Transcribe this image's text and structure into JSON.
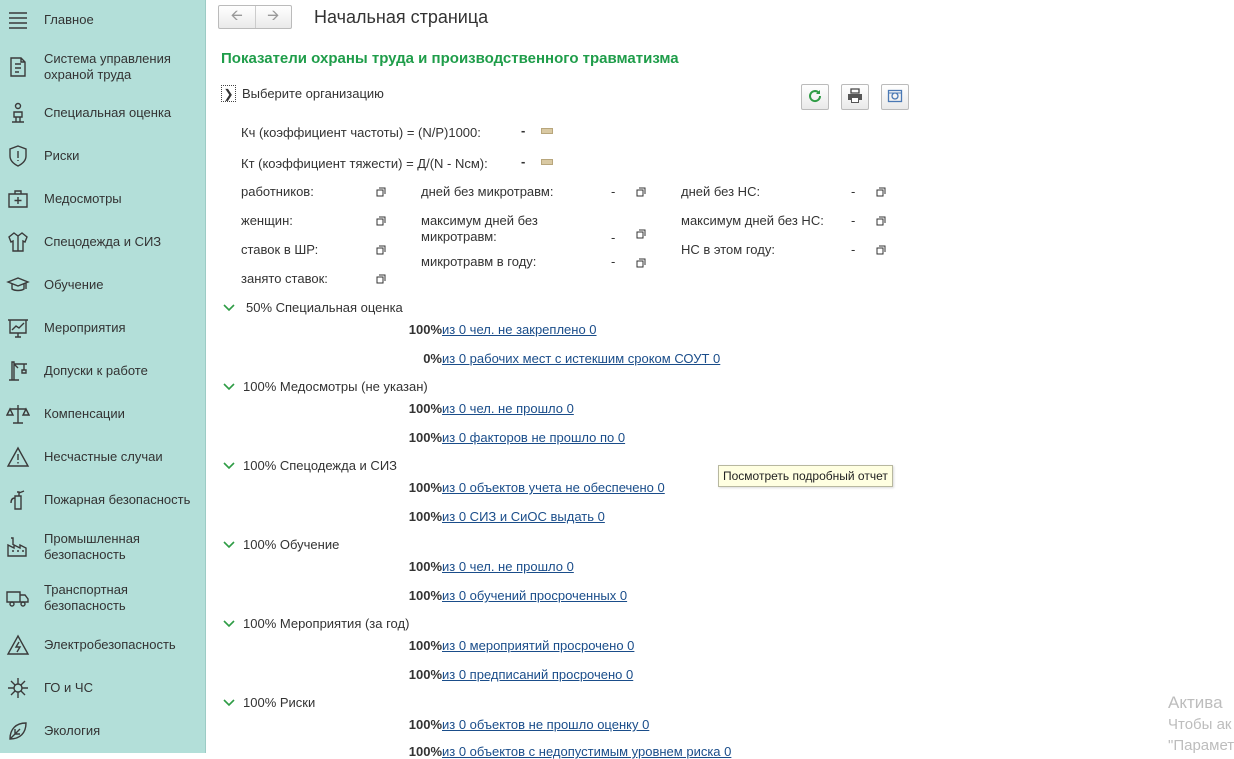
{
  "sidebar": {
    "items": [
      {
        "label": "Главное",
        "icon": "menu-icon"
      },
      {
        "label": "Система управления охраной труда",
        "icon": "document-icon"
      },
      {
        "label": "Специальная оценка",
        "icon": "workplace-chair-icon"
      },
      {
        "label": "Риски",
        "icon": "shield-icon"
      },
      {
        "label": "Медосмотры",
        "icon": "medkit-icon"
      },
      {
        "label": "Спецодежда и СИЗ",
        "icon": "jacket-icon"
      },
      {
        "label": "Обучение",
        "icon": "graduation-cap-icon"
      },
      {
        "label": "Мероприятия",
        "icon": "presentation-chart-icon"
      },
      {
        "label": "Допуски к работе",
        "icon": "crane-icon"
      },
      {
        "label": "Компенсации",
        "icon": "scales-icon"
      },
      {
        "label": "Несчастные случаи",
        "icon": "warning-icon"
      },
      {
        "label": "Пожарная безопасность",
        "icon": "fire-extinguisher-icon"
      },
      {
        "label": "Промышленная безопасность",
        "icon": "factory-icon"
      },
      {
        "label": "Транспортная безопасность",
        "icon": "truck-icon"
      },
      {
        "label": "Электробезопасность",
        "icon": "electric-warning-icon"
      },
      {
        "label": "ГО и ЧС",
        "icon": "civil-defense-icon"
      },
      {
        "label": "Экология",
        "icon": "ecology-icon"
      }
    ]
  },
  "header": {
    "back_icon": "arrow-left-icon",
    "forward_icon": "arrow-right-icon",
    "title": "Начальная страница"
  },
  "main": {
    "section_title": "Показатели охраны труда и производственного травматизма",
    "org_select": "Выберите организацию",
    "toolbar_icons": [
      "refresh-icon",
      "print-icon",
      "settings-icon"
    ],
    "coef_freq": {
      "label": "Кч (коэффициент частоты) = (N/P)1000:",
      "value": "-"
    },
    "coef_sev": {
      "label": "Кт (коэффициент тяжести) = Д/(N - Nсм):",
      "value": "-"
    },
    "stats_col1": [
      {
        "label": "работников:"
      },
      {
        "label": "женщин:"
      },
      {
        "label": "ставок в ШР:"
      },
      {
        "label": "занято ставок:"
      }
    ],
    "stats_col2": [
      {
        "label": "дней без микротравм:",
        "value": "-"
      },
      {
        "label": "максимум дней без микротравм:",
        "value": "-"
      },
      {
        "label": "микротравм в году:",
        "value": "-"
      }
    ],
    "stats_col3": [
      {
        "label": "дней без НС:",
        "value": "-"
      },
      {
        "label": "максимум дней без НС:",
        "value": "-"
      },
      {
        "label": "НС в этом году:",
        "value": "-"
      }
    ],
    "groups": [
      {
        "title": "50% Специальная оценка",
        "rows": [
          {
            "pct": "100%",
            "text": "из 0 чел. не закреплено 0"
          },
          {
            "pct": "0%",
            "text": "из 0 рабочих мест с истекшим сроком СОУТ 0"
          }
        ]
      },
      {
        "title": "100% Медосмотры (не указан)",
        "rows": [
          {
            "pct": "100%",
            "text": "из 0 чел. не прошло 0"
          },
          {
            "pct": "100%",
            "text": "из 0 факторов не прошло по 0"
          }
        ]
      },
      {
        "title": "100% Спецодежда и СИЗ",
        "rows": [
          {
            "pct": "100%",
            "text": "из 0 объектов учета не обеспечено 0"
          },
          {
            "pct": "100%",
            "text": "из 0 СИЗ и СиОС выдать 0"
          }
        ]
      },
      {
        "title": "100% Обучение",
        "rows": [
          {
            "pct": "100%",
            "text": "из 0 чел. не прошло 0"
          },
          {
            "pct": "100%",
            "text": "из 0 обучений просроченных 0"
          }
        ]
      },
      {
        "title": "100% Мероприятия (за год)",
        "rows": [
          {
            "pct": "100%",
            "text": "из 0 мероприятий просрочено 0"
          },
          {
            "pct": "100%",
            "text": "из 0 предписаний просрочено 0"
          }
        ]
      },
      {
        "title": "100% Риски",
        "rows": [
          {
            "pct": "100%",
            "text": "из 0 объектов не прошло оценку 0"
          },
          {
            "pct": "100%",
            "text": "из 0 объектов с недопустимым уровнем риска 0"
          }
        ]
      }
    ],
    "tooltip": "Посмотреть подробный отчет"
  },
  "watermark": {
    "line1": "Актива",
    "line2": "Чтобы ак",
    "line3": "\"Парамет"
  }
}
